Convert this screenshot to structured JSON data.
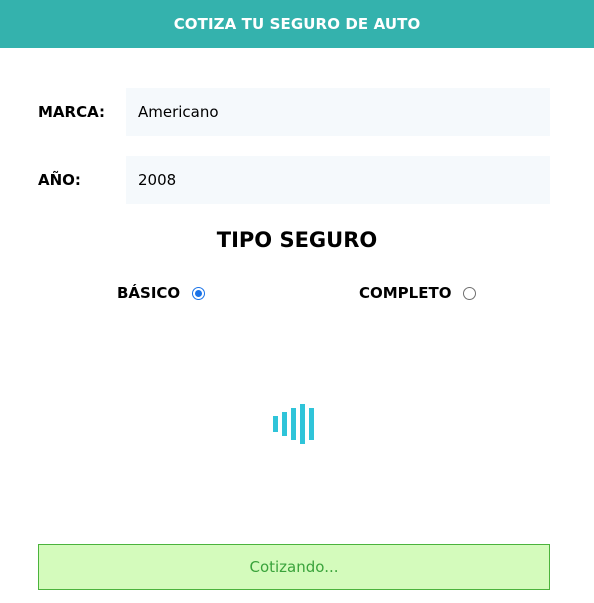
{
  "header": {
    "title": "COTIZA TU SEGURO DE AUTO",
    "background_color": "#34b2ad"
  },
  "form": {
    "marca": {
      "label": "MARCA:",
      "value": "Americano"
    },
    "anio": {
      "label": "AÑO:",
      "value": "2008"
    },
    "tipo_seguro": {
      "title": "TIPO SEGURO",
      "options": [
        {
          "label": "BÁSICO",
          "checked": true
        },
        {
          "label": "COMPLETO",
          "checked": false
        }
      ]
    }
  },
  "loading": {
    "icon": "loading-bars-icon",
    "color": "#2fc4d9"
  },
  "submit": {
    "label": "Cotizando...",
    "background_color": "#d4fbbc",
    "text_color": "#3aa33b"
  }
}
